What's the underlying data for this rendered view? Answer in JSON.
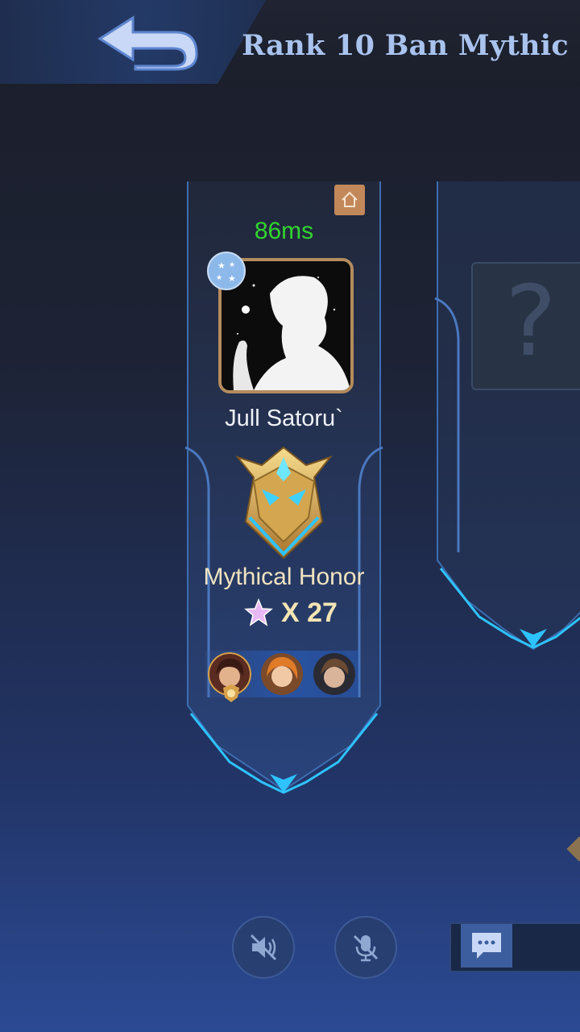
{
  "header": {
    "title": "Rank 10 Ban Mythic",
    "back_icon": "back-arrow-icon"
  },
  "player": {
    "ping": "86ms",
    "name": "Jull Satoru`",
    "rank_name": "Mythical Honor",
    "star_count": "X 27",
    "home_icon": "home-icon",
    "badge_icon": "star-badge-icon",
    "heroes": [
      "hero-1",
      "hero-2",
      "hero-3"
    ]
  },
  "empty_slot": {
    "placeholder": "?"
  },
  "controls": {
    "speaker_icon": "speaker-muted-icon",
    "mic_icon": "mic-muted-icon",
    "chat_icon": "chat-icon"
  },
  "colors": {
    "ping": "#31d52f",
    "title": "#a9c3ee",
    "avatar_border": "#b48c5e",
    "accent": "#2ec3ff"
  }
}
